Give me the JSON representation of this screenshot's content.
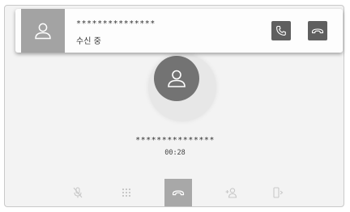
{
  "banner": {
    "avatar_icon": "person-icon",
    "caller_name": "***************",
    "status": "수신 중",
    "answer_icon": "phone-answer-icon",
    "decline_icon": "phone-hangup-icon"
  },
  "call": {
    "avatar_icon": "person-icon",
    "caller_name": "***************",
    "duration": "00:28"
  },
  "controls": [
    {
      "icon": "microphone-mute-icon",
      "enabled": false
    },
    {
      "icon": "keypad-icon",
      "enabled": false
    },
    {
      "icon": "phone-hangup-icon",
      "enabled": true
    },
    {
      "icon": "add-person-icon",
      "enabled": false
    },
    {
      "icon": "transfer-audio-icon",
      "enabled": false
    }
  ],
  "colors": {
    "background": "#f3f3f3",
    "banner_avatar": "#a3a3a3",
    "button_dark": "#5f5f5f",
    "main_avatar": "#737373",
    "end_call_button": "#a8a8a8",
    "disabled_icon": "#c8c8c8"
  }
}
